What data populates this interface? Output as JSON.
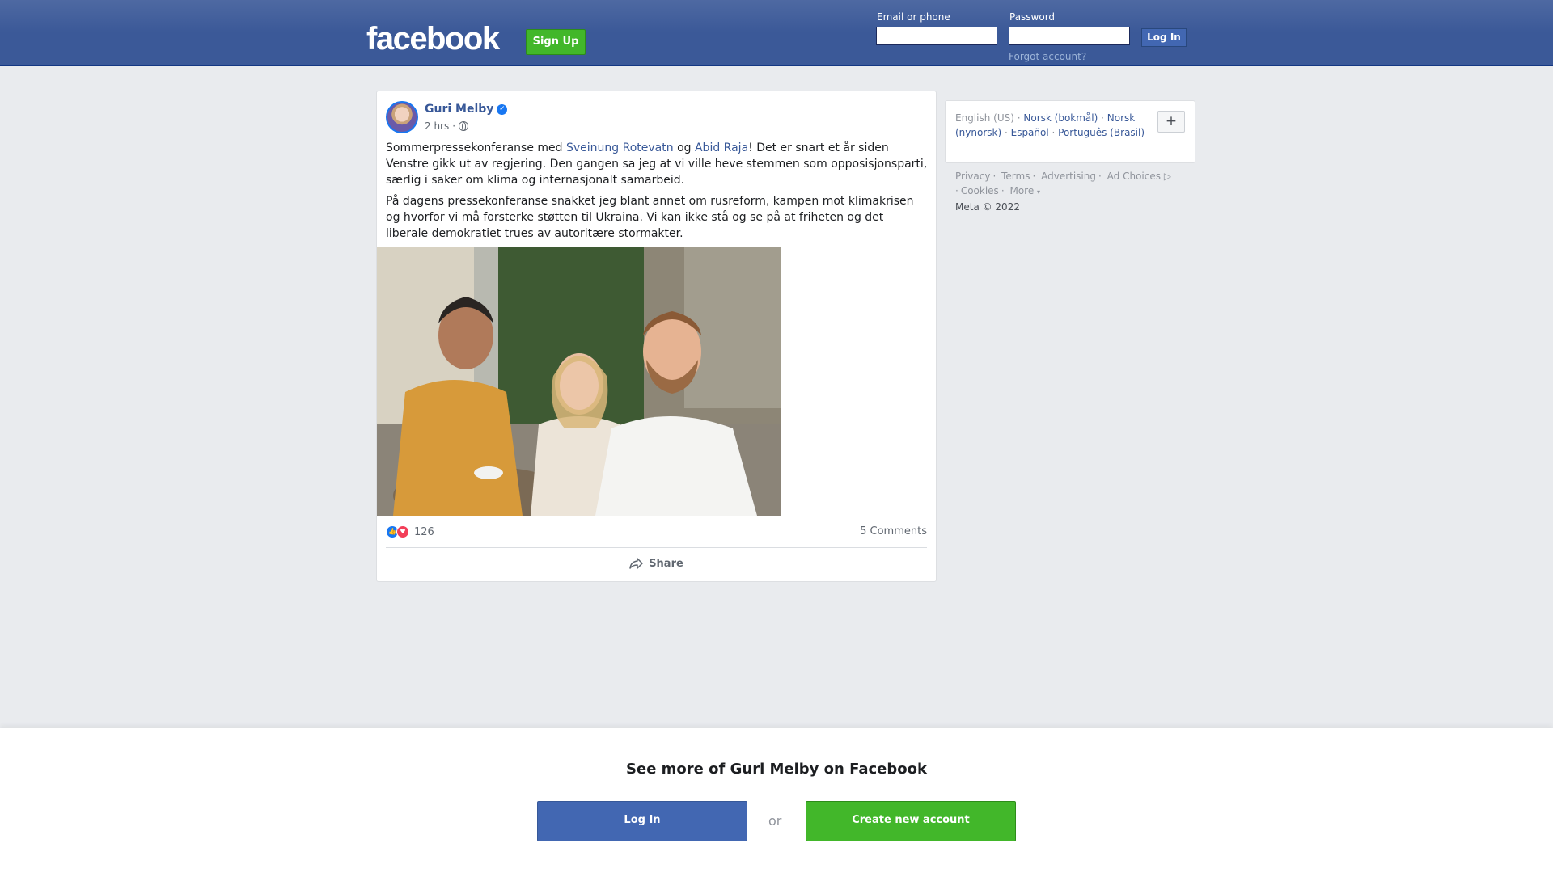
{
  "header": {
    "logo": "facebook",
    "signup_label": "Sign Up",
    "email_label": "Email or phone",
    "email_value": "",
    "password_label": "Password",
    "password_value": "",
    "login_label": "Log In",
    "forgot_label": "Forgot account?"
  },
  "post": {
    "author": "Guri Melby",
    "verified_icon": "verified-badge-icon",
    "time": "2 hrs",
    "separator": "·",
    "privacy_icon": "globe-icon",
    "text_part1": "Sommerpressekonferanse med ",
    "mention1": "Sveinung Rotevatn",
    "text_part2": " og ",
    "mention2": "Abid Raja",
    "text_part3": "! Det er snart et år siden Venstre gikk ut av regjering. Den gangen sa jeg at vi ville heve stemmen som opposisjonsparti, særlig i saker om klima og internasjonalt samarbeid.",
    "paragraph2": "På dagens pressekonferanse snakket jeg blant annet om rusreform, kampen mot klimakrisen og hvorfor vi må forsterke støtten til Ukraina. Vi kan ikke stå og se på at friheten og det liberale demokratiet trues av autoritære stormakter.",
    "reaction_icons": [
      "like-icon",
      "love-icon"
    ],
    "reaction_count": "126",
    "comments": "5 Comments",
    "share_label": "Share"
  },
  "languages": {
    "current": "English (US)",
    "options": [
      "Norsk (bokmål)",
      "Norsk (nynorsk)",
      "Español",
      "Português (Brasil)"
    ],
    "more_button": "+"
  },
  "footer": {
    "links": [
      "Privacy",
      "Terms",
      "Advertising",
      "Ad Choices",
      "Cookies",
      "More"
    ],
    "copyright": "Meta © 2022"
  },
  "bottom_cta": {
    "title": "See more of Guri Melby on Facebook",
    "login_label": "Log In",
    "or_label": "or",
    "create_label": "Create new account"
  },
  "colors": {
    "header_blue": "#3b5998",
    "link_blue": "#385898",
    "signup_green": "#42b72a",
    "button_blue": "#4267b2"
  }
}
